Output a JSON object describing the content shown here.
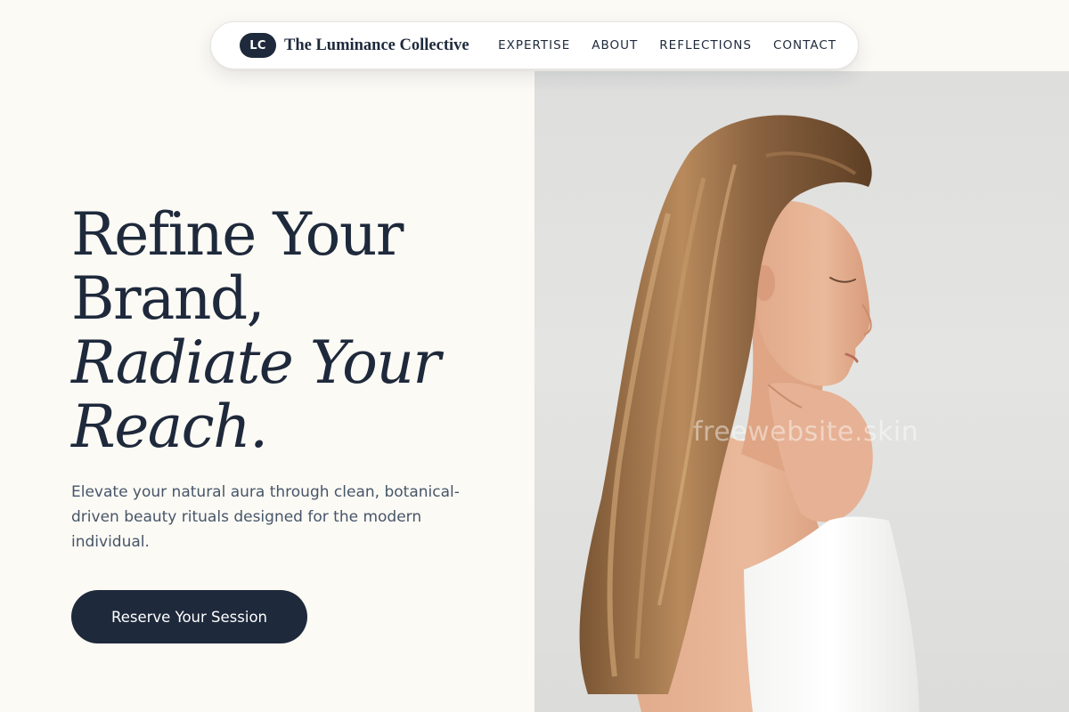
{
  "nav": {
    "logo_initials": "LC",
    "brand_name": "The Luminance Collective",
    "links": [
      {
        "label": "EXPERTISE"
      },
      {
        "label": "ABOUT"
      },
      {
        "label": "REFLECTIONS"
      },
      {
        "label": "CONTACT"
      }
    ]
  },
  "hero": {
    "headline_line1": "Refine Your",
    "headline_line2": "Brand,",
    "headline_accent1": "Radiate Your",
    "headline_accent2": "Reach.",
    "subtitle": "Elevate your natural aura through clean, botanical-driven beauty rituals designed for the modern individual.",
    "cta_label": "Reserve Your Session"
  },
  "photo": {
    "watermark": "freewebsite.skin"
  },
  "colors": {
    "background": "#fcfaf5",
    "primary": "#1e293b",
    "text_muted": "#475569",
    "photo_bg": "#dededd"
  }
}
